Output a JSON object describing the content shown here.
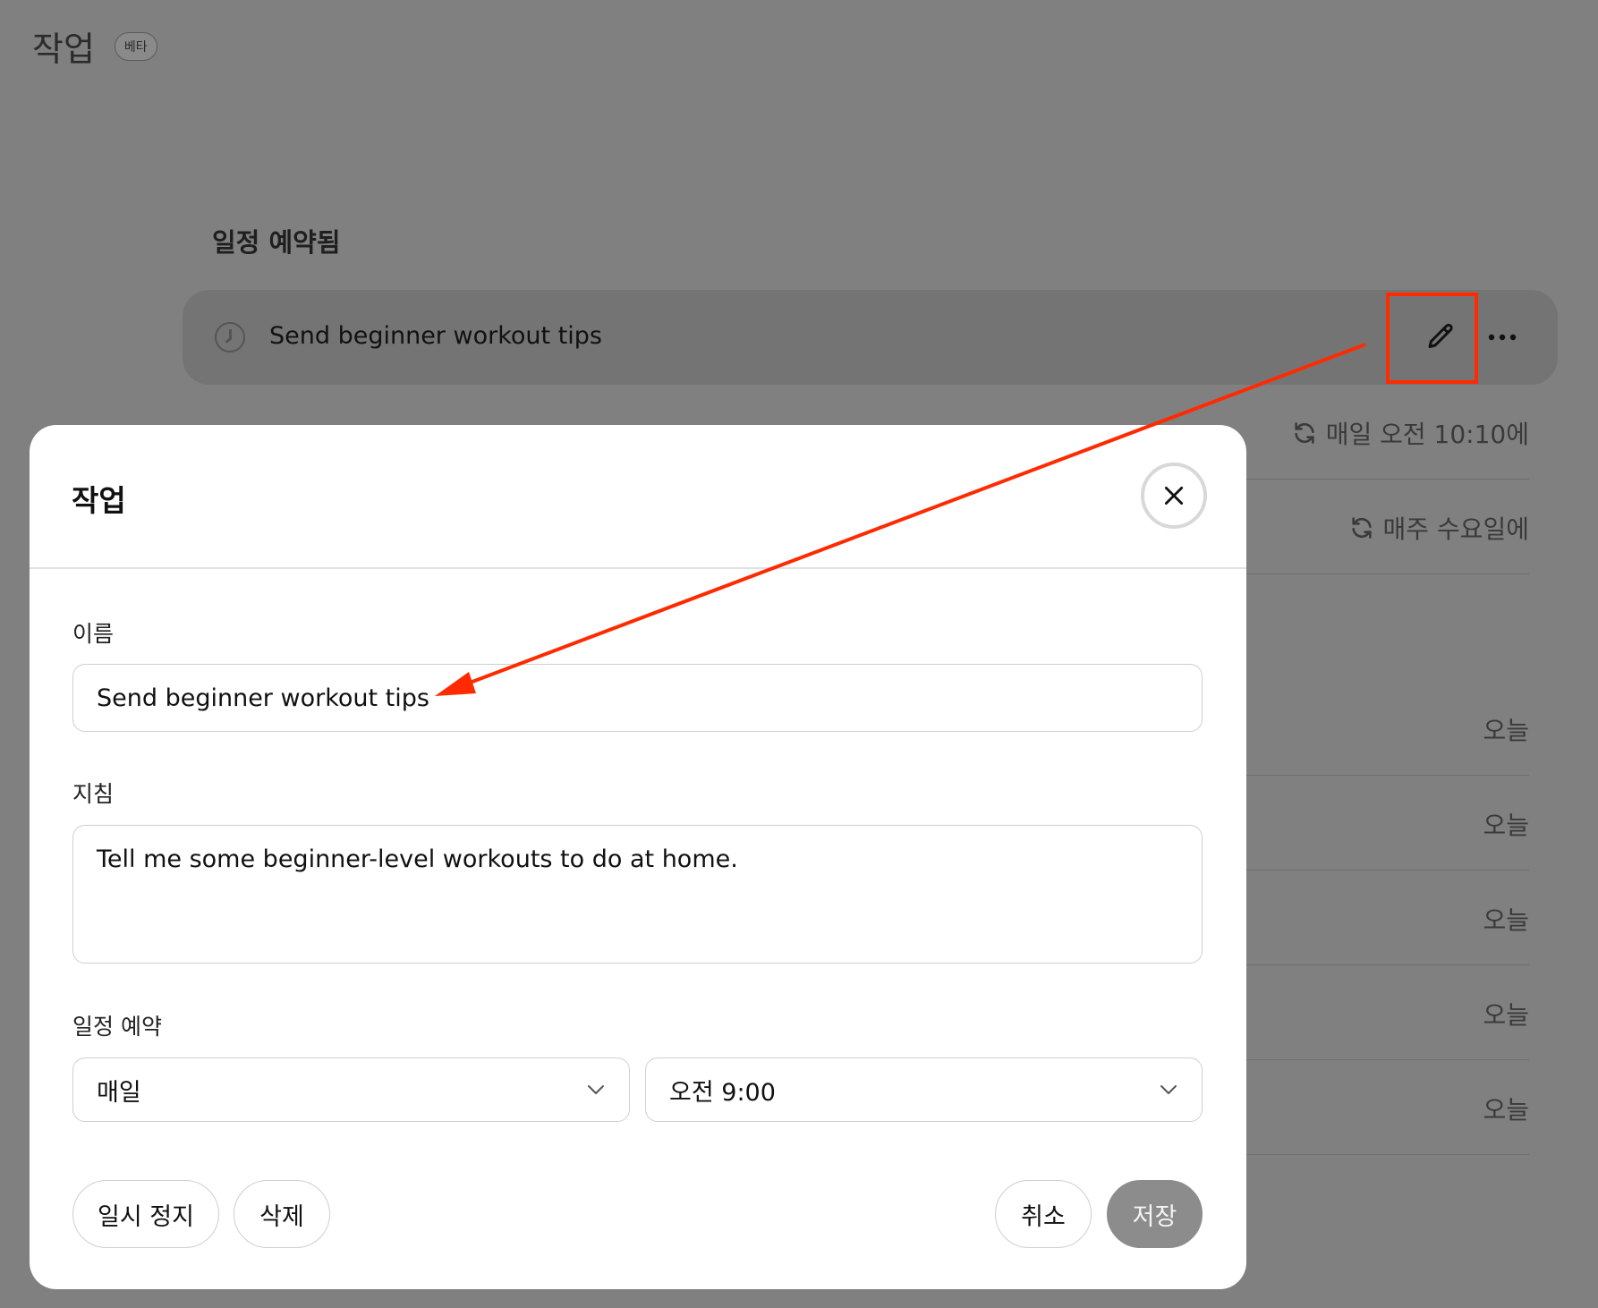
{
  "page": {
    "title": "작업",
    "badge": "베타",
    "section_title": "일정 예약됨"
  },
  "tasks": [
    {
      "name": "Send beginner workout tips",
      "schedule": ""
    },
    {
      "name": "",
      "schedule": "매일 오전 10:10에"
    },
    {
      "name": "",
      "schedule": "매주 수요일에"
    },
    {
      "name": "",
      "date": "오늘"
    },
    {
      "name": "",
      "date": "오늘"
    },
    {
      "name": "",
      "date": "오늘"
    },
    {
      "name": "",
      "date": "오늘"
    },
    {
      "name": "",
      "date": "오늘"
    }
  ],
  "modal": {
    "title": "작업",
    "name_label": "이름",
    "name_value": "Send beginner workout tips",
    "instructions_label": "지침",
    "instructions_value": "Tell me some beginner-level workouts to do at home.",
    "schedule_label": "일정 예약",
    "frequency_value": "매일",
    "time_value": "오전 9:00",
    "pause_label": "일시 정지",
    "delete_label": "삭제",
    "cancel_label": "취소",
    "save_label": "저장"
  },
  "colors": {
    "annotation": "#ff2a00",
    "save_button": "#8c8c8c",
    "overlay": "#808080"
  }
}
